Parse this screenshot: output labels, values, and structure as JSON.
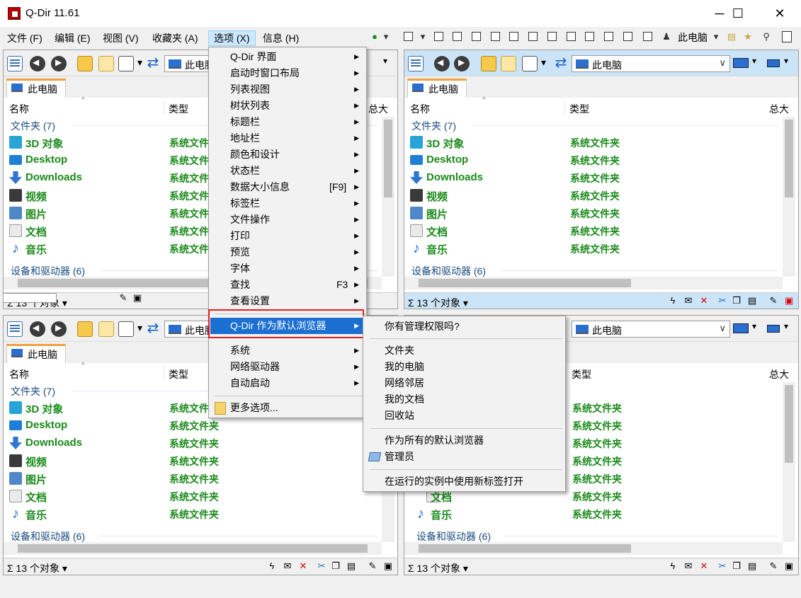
{
  "window": {
    "title": "Q-Dir 11.61",
    "minimize": "─",
    "maximize": "☐",
    "close": "✕"
  },
  "menubar": [
    {
      "label": "文件 (F)"
    },
    {
      "label": "编辑 (E)"
    },
    {
      "label": "视图 (V)"
    },
    {
      "label": "收藏夹 (A)"
    },
    {
      "label": "选项 (X)",
      "active": true
    },
    {
      "label": "信息 (H)"
    }
  ],
  "global_toolbar": {
    "computer_label": "此电脑"
  },
  "pane": {
    "address": "此电脑",
    "tab_label": "此电脑",
    "col_name": "名称",
    "col_type": "类型",
    "col_size": "总大",
    "group_folders": "文件夹 (7)",
    "group_devices": "设备和驱动器 (6)",
    "status_count": "13 个对象",
    "rows": [
      {
        "name": "3D 对象",
        "type": "系统文件夹",
        "icon": "cube-icon"
      },
      {
        "name": "Desktop",
        "type": "系统文件夹",
        "icon": "desktop-icon"
      },
      {
        "name": "Downloads",
        "type": "系统文件夹",
        "icon": "download-icon"
      },
      {
        "name": "视频",
        "type": "系统文件夹",
        "icon": "video-icon"
      },
      {
        "name": "图片",
        "type": "系统文件夹",
        "icon": "picture-icon"
      },
      {
        "name": "文档",
        "type": "系统文件夹",
        "icon": "document-icon"
      },
      {
        "name": "音乐",
        "type": "系统文件夹",
        "icon": "music-icon"
      }
    ]
  },
  "options_menu": {
    "items": [
      {
        "label": "Q-Dir 界面",
        "sub": true
      },
      {
        "label": "启动时窗口布局",
        "sub": true
      },
      {
        "label": "列表视图",
        "sub": true
      },
      {
        "label": "树状列表",
        "sub": true
      },
      {
        "label": "标题栏",
        "sub": true
      },
      {
        "label": "地址栏",
        "sub": true
      },
      {
        "label": "颜色和设计",
        "sub": true
      },
      {
        "label": "状态栏",
        "sub": true
      },
      {
        "label": "数据大小信息",
        "shortcut": "[F9]",
        "sub": true
      },
      {
        "label": "标签栏",
        "sub": true
      },
      {
        "label": "文件操作",
        "sub": true
      },
      {
        "label": "打印",
        "sub": true
      },
      {
        "label": "预览",
        "sub": true
      },
      {
        "label": "字体",
        "sub": true
      },
      {
        "label": "查找",
        "shortcut": "F3",
        "sub": true
      },
      {
        "label": "查看设置",
        "sub": true
      }
    ],
    "highlighted": "Q-Dir 作为默认浏览器",
    "lower_items": [
      {
        "label": "系统",
        "sub": true
      },
      {
        "label": "网络驱动器",
        "sub": true
      },
      {
        "label": "自动启动",
        "sub": true
      }
    ],
    "more": "更多选项..."
  },
  "submenu": {
    "admin_question": "你有管理权限吗?",
    "targets": [
      "文件夹",
      "我的电脑",
      "网络邻居",
      "我的文档",
      "回收站"
    ],
    "all_default": "作为所有的默认浏览器",
    "admin": "管理员",
    "new_tab": "在运行的实例中使用新标签打开"
  },
  "colors": {
    "accent": "#1a6fd1",
    "folder_green": "#1a8a1a",
    "highlight_red": "#e81e1e",
    "active_pane": "#cce4f7"
  }
}
